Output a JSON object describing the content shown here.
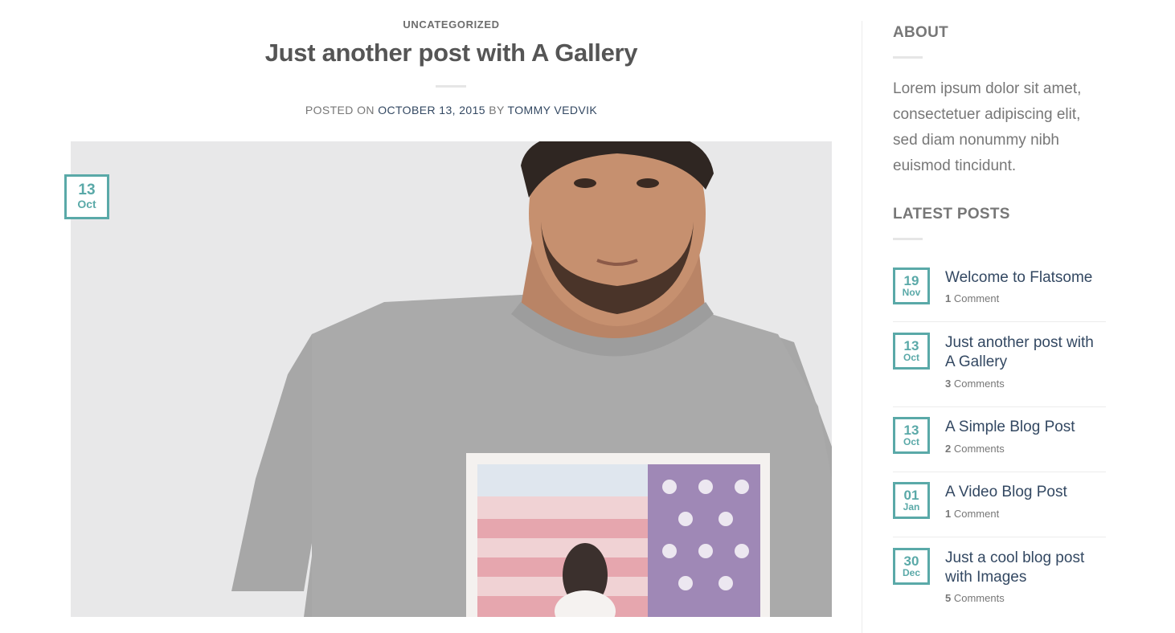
{
  "post": {
    "category": "UNCATEGORIZED",
    "title": "Just another post with A Gallery",
    "meta_prefix": "POSTED ON",
    "date": "OCTOBER 13, 2015",
    "meta_by": "BY",
    "author": "TOMMY VEDVIK",
    "badge_day": "13",
    "badge_month": "Oct"
  },
  "sidebar": {
    "about_title": "ABOUT",
    "about_text": "Lorem ipsum dolor sit amet, consectetuer adipiscing elit, sed diam nonummy nibh euismod tincidunt.",
    "latest_title": "LATEST POSTS",
    "latest_posts": [
      {
        "day": "19",
        "month": "Nov",
        "title": "Welcome to Flatsome",
        "count": "1",
        "comments": "Comment"
      },
      {
        "day": "13",
        "month": "Oct",
        "title": "Just another post with A Gallery",
        "count": "3",
        "comments": "Comments"
      },
      {
        "day": "13",
        "month": "Oct",
        "title": "A Simple Blog Post",
        "count": "2",
        "comments": "Comments"
      },
      {
        "day": "01",
        "month": "Jan",
        "title": "A Video Blog Post",
        "count": "1",
        "comments": "Comment"
      },
      {
        "day": "30",
        "month": "Dec",
        "title": "Just a cool blog post with Images",
        "count": "5",
        "comments": "Comments"
      }
    ]
  },
  "colors": {
    "accent": "#5aa9a8",
    "link": "#334862",
    "text": "#777777"
  }
}
